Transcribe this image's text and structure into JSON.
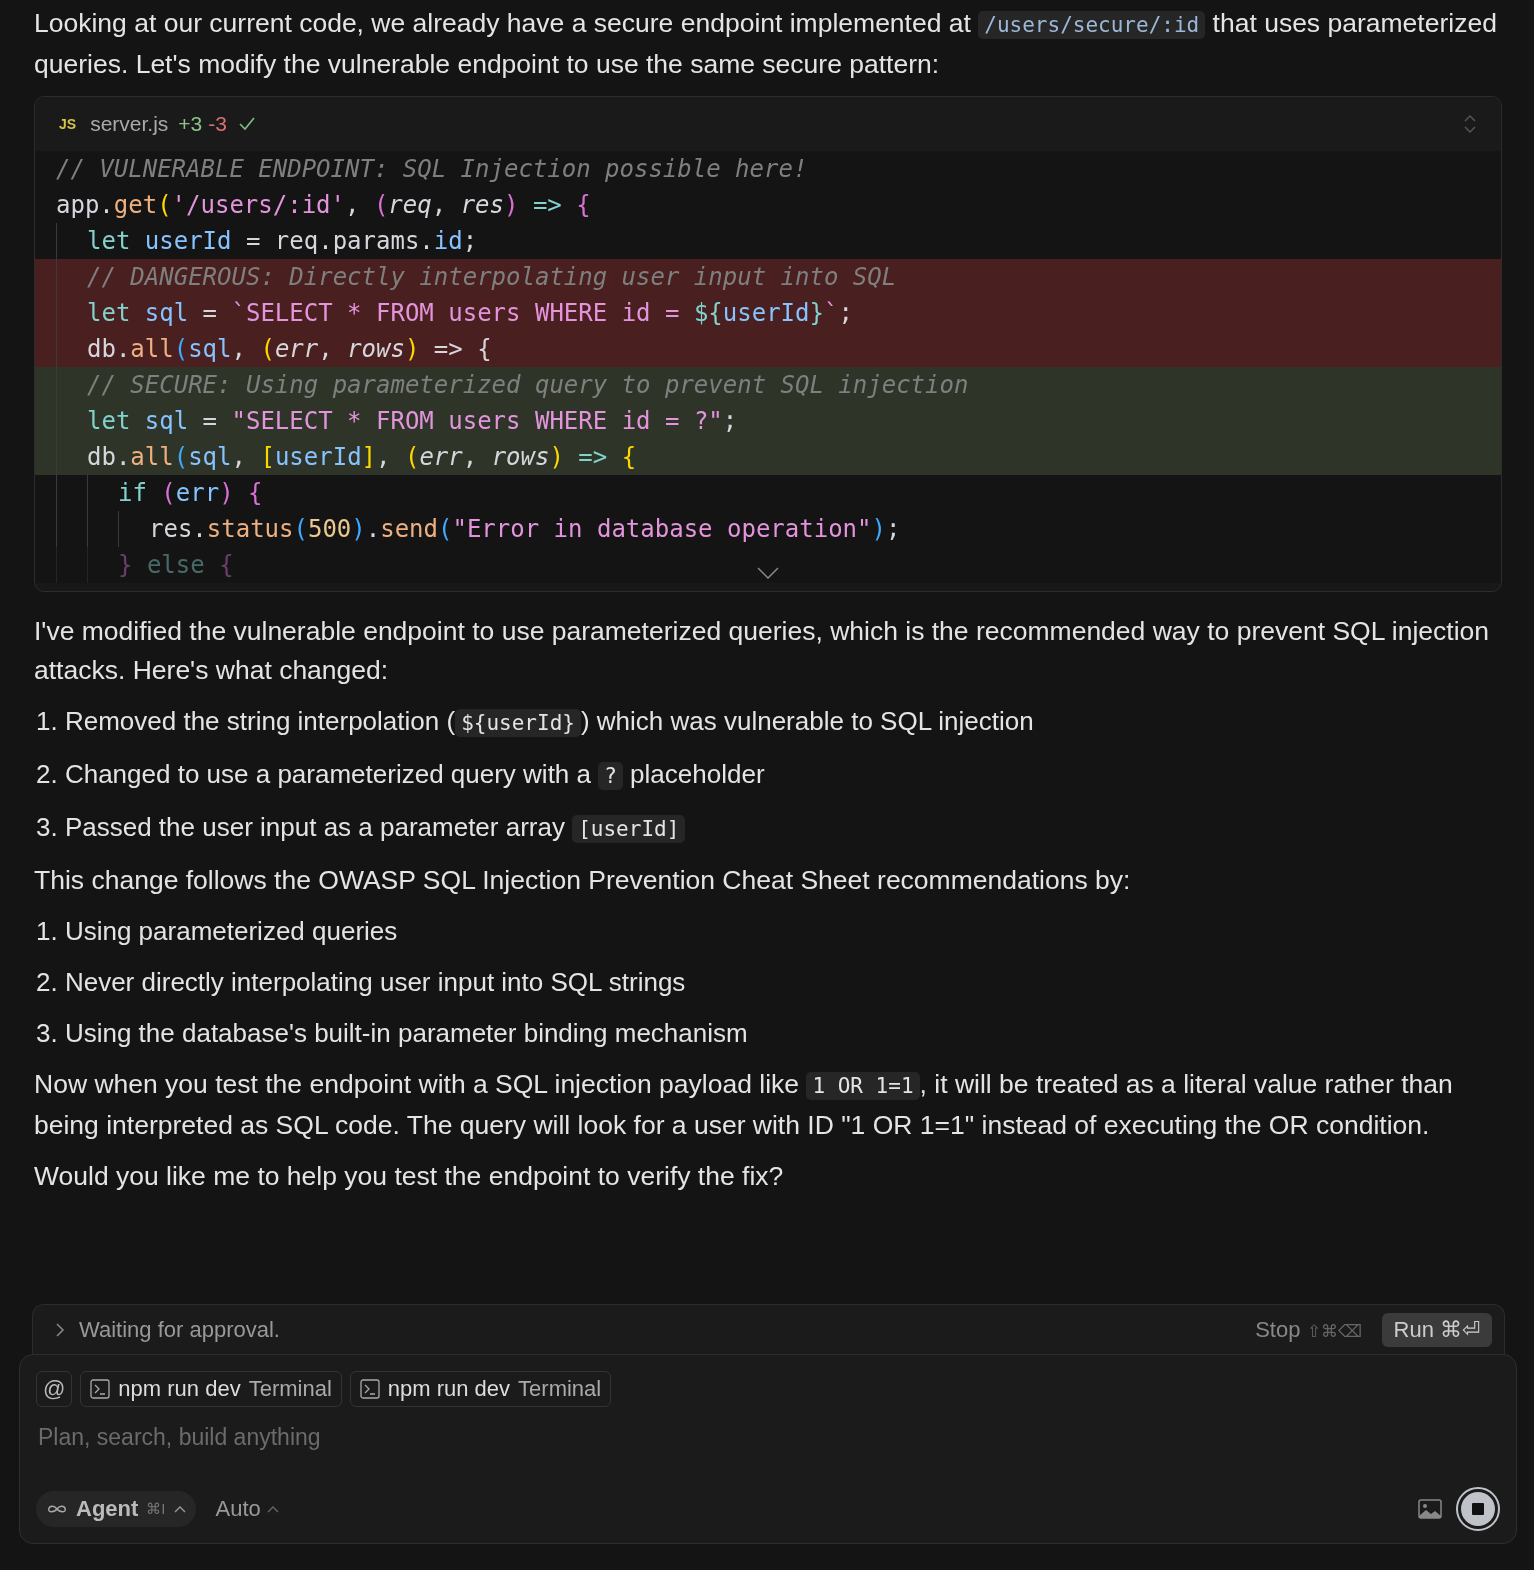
{
  "intro": [
    {
      "kind": "text",
      "text": "Looking at our current code, we already have a secure endpoint implemented at "
    },
    {
      "kind": "code",
      "text": "/users/secure/:id"
    },
    {
      "kind": "text",
      "text": " that uses parameterized queries. Let's modify the vulnerable endpoint to use the same secure pattern:"
    }
  ],
  "code_block": {
    "lang_badge": "JS",
    "file": "server.js",
    "added": "+3",
    "removed": "-3",
    "applied": true,
    "lines": [
      {
        "removed": false,
        "added": false,
        "faded": false,
        "tokens": [
          {
            "kind": "comment",
            "text": "// VULNERABLE ENDPOINT: SQL Injection possible here!"
          }
        ]
      },
      {
        "removed": false,
        "added": false,
        "faded": false,
        "tokens": [
          {
            "kind": "plain",
            "text": "app."
          },
          {
            "kind": "func",
            "text": "get"
          },
          {
            "kind": "paren1",
            "text": "("
          },
          {
            "kind": "string",
            "text": "'/users/:id'"
          },
          {
            "kind": "plain",
            "text": ", "
          },
          {
            "kind": "paren2",
            "text": "("
          },
          {
            "kind": "param",
            "text": "req"
          },
          {
            "kind": "plain",
            "text": ", "
          },
          {
            "kind": "param",
            "text": "res"
          },
          {
            "kind": "paren2",
            "text": ")"
          },
          {
            "kind": "keyword",
            "text": " => "
          },
          {
            "kind": "paren2",
            "text": "{"
          }
        ]
      },
      {
        "removed": false,
        "added": false,
        "faded": false,
        "tokens": [
          {
            "kind": "keyword",
            "text": "  let "
          },
          {
            "kind": "var",
            "text": "userId"
          },
          {
            "kind": "plain",
            "text": " = req.params."
          },
          {
            "kind": "var",
            "text": "id"
          },
          {
            "kind": "plain",
            "text": ";"
          }
        ]
      },
      {
        "removed": true,
        "added": false,
        "faded": false,
        "tokens": [
          {
            "kind": "comment",
            "text": "  // DANGEROUS: Directly interpolating user input into SQL"
          }
        ]
      },
      {
        "removed": true,
        "added": false,
        "faded": false,
        "tokens": [
          {
            "kind": "keyword",
            "text": "  let "
          },
          {
            "kind": "var",
            "text": "sql"
          },
          {
            "kind": "plain",
            "text": " = "
          },
          {
            "kind": "string",
            "text": "`SELECT * FROM users WHERE id = "
          },
          {
            "kind": "keyword",
            "text": "${"
          },
          {
            "kind": "var",
            "text": "userId"
          },
          {
            "kind": "keyword",
            "text": "}"
          },
          {
            "kind": "string",
            "text": "`"
          },
          {
            "kind": "plain",
            "text": ";"
          }
        ]
      },
      {
        "removed": true,
        "added": false,
        "faded": false,
        "tokens": [
          {
            "kind": "plain",
            "text": "  db."
          },
          {
            "kind": "func",
            "text": "all"
          },
          {
            "kind": "paren3",
            "text": "("
          },
          {
            "kind": "var",
            "text": "sql"
          },
          {
            "kind": "plain",
            "text": ", "
          },
          {
            "kind": "paren1",
            "text": "("
          },
          {
            "kind": "param",
            "text": "err"
          },
          {
            "kind": "plain",
            "text": ", "
          },
          {
            "kind": "param",
            "text": "rows"
          },
          {
            "kind": "paren1",
            "text": ")"
          },
          {
            "kind": "plain",
            "text": " => {"
          }
        ]
      },
      {
        "removed": false,
        "added": true,
        "faded": false,
        "tokens": [
          {
            "kind": "comment",
            "text": "  // SECURE: Using parameterized query to prevent SQL injection"
          }
        ]
      },
      {
        "removed": false,
        "added": true,
        "faded": false,
        "tokens": [
          {
            "kind": "keyword",
            "text": "  let "
          },
          {
            "kind": "var",
            "text": "sql"
          },
          {
            "kind": "plain",
            "text": " = "
          },
          {
            "kind": "string",
            "text": "\"SELECT * FROM users WHERE id = ?\""
          },
          {
            "kind": "plain",
            "text": ";"
          }
        ]
      },
      {
        "removed": false,
        "added": true,
        "faded": false,
        "tokens": [
          {
            "kind": "plain",
            "text": "  db."
          },
          {
            "kind": "func",
            "text": "all"
          },
          {
            "kind": "paren3",
            "text": "("
          },
          {
            "kind": "var",
            "text": "sql"
          },
          {
            "kind": "plain",
            "text": ", "
          },
          {
            "kind": "paren1",
            "text": "["
          },
          {
            "kind": "var",
            "text": "userId"
          },
          {
            "kind": "paren1",
            "text": "]"
          },
          {
            "kind": "plain",
            "text": ", "
          },
          {
            "kind": "paren1",
            "text": "("
          },
          {
            "kind": "param",
            "text": "err"
          },
          {
            "kind": "plain",
            "text": ", "
          },
          {
            "kind": "param",
            "text": "rows"
          },
          {
            "kind": "paren1",
            "text": ")"
          },
          {
            "kind": "keyword",
            "text": " => "
          },
          {
            "kind": "paren1",
            "text": "{"
          }
        ]
      },
      {
        "removed": false,
        "added": false,
        "faded": false,
        "tokens": [
          {
            "kind": "keyword",
            "text": "    if "
          },
          {
            "kind": "paren2",
            "text": "("
          },
          {
            "kind": "var",
            "text": "err"
          },
          {
            "kind": "paren2",
            "text": ")"
          },
          {
            "kind": "paren2",
            "text": " {"
          }
        ]
      },
      {
        "removed": false,
        "added": false,
        "faded": false,
        "tokens": [
          {
            "kind": "plain",
            "text": "      res."
          },
          {
            "kind": "func",
            "text": "status"
          },
          {
            "kind": "paren3",
            "text": "("
          },
          {
            "kind": "number",
            "text": "500"
          },
          {
            "kind": "paren3",
            "text": ")"
          },
          {
            "kind": "plain",
            "text": "."
          },
          {
            "kind": "func",
            "text": "send"
          },
          {
            "kind": "paren3",
            "text": "("
          },
          {
            "kind": "string",
            "text": "\"Error in database operation\""
          },
          {
            "kind": "paren3",
            "text": ")"
          },
          {
            "kind": "plain",
            "text": ";"
          }
        ]
      },
      {
        "removed": false,
        "added": false,
        "faded": true,
        "tokens": [
          {
            "kind": "paren2",
            "text": "    }"
          },
          {
            "kind": "keyword",
            "text": " else "
          },
          {
            "kind": "paren2",
            "text": "{"
          }
        ]
      }
    ]
  },
  "blocks": [
    {
      "kind": "para",
      "segments": [
        {
          "kind": "text",
          "text": "I've modified the vulnerable endpoint to use parameterized queries, which is the recommended way to prevent SQL injection attacks. Here's what changed:"
        }
      ]
    },
    {
      "kind": "list",
      "items": [
        [
          {
            "kind": "text",
            "text": "1. Removed the string interpolation ("
          },
          {
            "kind": "code",
            "text": "${userId}"
          },
          {
            "kind": "text",
            "text": ") which was vulnerable to SQL injection"
          }
        ],
        [
          {
            "kind": "text",
            "text": "2. Changed to use a parameterized query with a "
          },
          {
            "kind": "code",
            "text": "?"
          },
          {
            "kind": "text",
            "text": " placeholder"
          }
        ],
        [
          {
            "kind": "text",
            "text": "3. Passed the user input as a parameter array "
          },
          {
            "kind": "code",
            "text": "[userId]"
          }
        ]
      ]
    },
    {
      "kind": "para",
      "segments": [
        {
          "kind": "text",
          "text": "This change follows the OWASP SQL Injection Prevention Cheat Sheet recommendations by:"
        }
      ]
    },
    {
      "kind": "list",
      "items": [
        [
          {
            "kind": "text",
            "text": "1. Using parameterized queries"
          }
        ],
        [
          {
            "kind": "text",
            "text": "2. Never directly interpolating user input into SQL strings"
          }
        ],
        [
          {
            "kind": "text",
            "text": "3. Using the database's built-in parameter binding mechanism"
          }
        ]
      ]
    },
    {
      "kind": "para",
      "segments": [
        {
          "kind": "text",
          "text": "Now when you test the endpoint with a SQL injection payload like "
        },
        {
          "kind": "code",
          "text": "1 OR 1=1"
        },
        {
          "kind": "text",
          "text": ", it will be treated as a literal value rather than being interpreted as SQL code. The query will look for a user with ID \"1 OR 1=1\" instead of executing the OR condition."
        }
      ]
    },
    {
      "kind": "para",
      "segments": [
        {
          "kind": "text",
          "text": "Would you like me to help you test the endpoint to verify the fix?"
        }
      ]
    }
  ],
  "approval": {
    "status": "Waiting for approval.",
    "stop_label": "Stop",
    "stop_keys": "⇧⌘⌫",
    "run_label": "Run ⌘⏎"
  },
  "composer": {
    "at": "@",
    "chips": [
      {
        "name": "npm run dev",
        "type": "Terminal"
      },
      {
        "name": "npm run dev",
        "type": "Terminal"
      }
    ],
    "placeholder": "Plan, search, build anything",
    "mode": "Agent",
    "mode_keys": "⌘I",
    "model": "Auto"
  }
}
